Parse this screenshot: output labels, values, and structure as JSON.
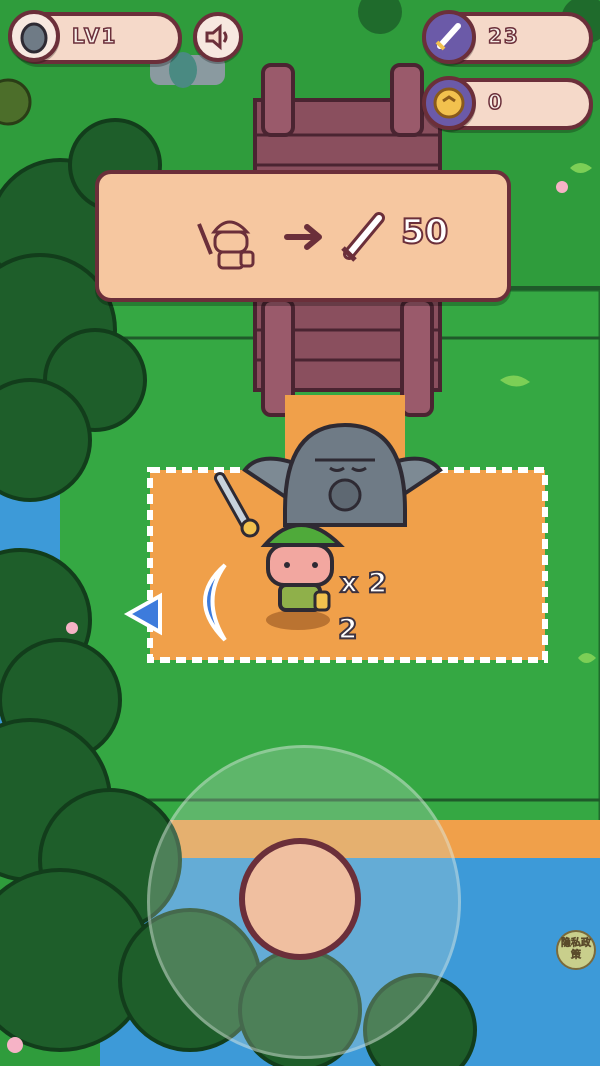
{
  "hud": {
    "level_label": "LV1",
    "swords_count": "23",
    "coins_count": "0"
  },
  "upgrade_panel": {
    "cost": "50"
  },
  "player": {
    "multiplier_label": "x 2",
    "count_label": "2"
  },
  "privacy_button": {
    "label": "隐私政策"
  },
  "icons": {
    "level_avatar": "statue-icon",
    "sound": "speaker-icon",
    "swords": "sword-icon",
    "coins": "coin-icon",
    "left_arrow": "left-arrow-icon"
  },
  "colors": {
    "grass": "#2f9c3c",
    "dirt": "#f0a04a",
    "water": "#3d9ad8",
    "outline": "#6b2f3a",
    "panel": "#f6c7a0"
  }
}
